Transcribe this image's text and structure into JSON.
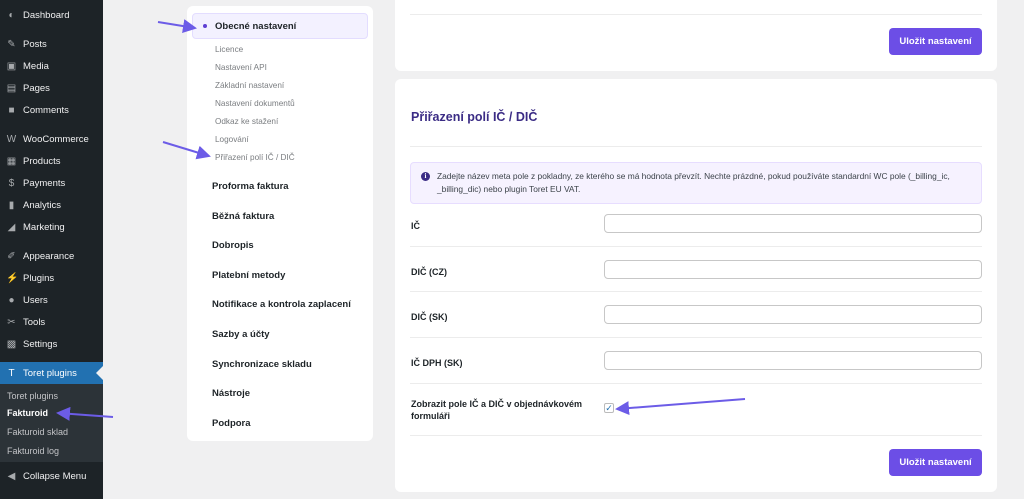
{
  "sidebar": {
    "items": [
      {
        "label": "Dashboard",
        "icon": "dashboard-icon",
        "glyph": "◐"
      },
      {
        "label": "Posts",
        "icon": "pin-icon",
        "glyph": "✎"
      },
      {
        "label": "Media",
        "icon": "media-icon",
        "glyph": "▣"
      },
      {
        "label": "Pages",
        "icon": "pages-icon",
        "glyph": "▤"
      },
      {
        "label": "Comments",
        "icon": "comments-icon",
        "glyph": "■"
      },
      {
        "label": "WooCommerce",
        "icon": "woocommerce-icon",
        "glyph": "W"
      },
      {
        "label": "Products",
        "icon": "products-icon",
        "glyph": "▦"
      },
      {
        "label": "Payments",
        "icon": "payments-icon",
        "glyph": "$"
      },
      {
        "label": "Analytics",
        "icon": "analytics-icon",
        "glyph": "▮"
      },
      {
        "label": "Marketing",
        "icon": "megaphone-icon",
        "glyph": "◢"
      },
      {
        "label": "Appearance",
        "icon": "brush-icon",
        "glyph": "✐"
      },
      {
        "label": "Plugins",
        "icon": "plugins-icon",
        "glyph": "⚡"
      },
      {
        "label": "Users",
        "icon": "users-icon",
        "glyph": "●"
      },
      {
        "label": "Tools",
        "icon": "wrench-icon",
        "glyph": "✂"
      },
      {
        "label": "Settings",
        "icon": "settings-icon",
        "glyph": "▩"
      },
      {
        "label": "Toret plugins",
        "icon": "toret-icon",
        "glyph": "T"
      },
      {
        "label": "Collapse Menu",
        "icon": "collapse-icon",
        "glyph": "◀"
      }
    ],
    "submenu": [
      "Toret plugins",
      "Fakturoid",
      "Fakturoid sklad",
      "Fakturoid log"
    ]
  },
  "nav": {
    "active": "Obecné nastavení",
    "subitems": [
      "Licence",
      "Nastavení API",
      "Základní nastavení",
      "Nastavení dokumentů",
      "Odkaz ke stažení",
      "Logování",
      "Přiřazení polí IČ / DIČ"
    ],
    "main": [
      "Proforma faktura",
      "Běžná faktura",
      "Dobropis",
      "Platební metody",
      "Notifikace a kontrola zaplacení",
      "Sazby a účty",
      "Synchronizace skladu",
      "Nástroje",
      "Podpora"
    ]
  },
  "top_card": {
    "save_label": "Uložit nastavení"
  },
  "main_card": {
    "title": "Přiřazení polí IČ / DIČ",
    "notice": "Zadejte název meta pole z pokladny, ze kterého se má hodnota převzít. Nechte prázdné, pokud používáte standardní WC pole (_billing_ic, _billing_dic) nebo plugin Toret EU VAT.",
    "fields": [
      {
        "label": "IČ",
        "value": ""
      },
      {
        "label": "DIČ (CZ)",
        "value": ""
      },
      {
        "label": "DIČ (SK)",
        "value": ""
      },
      {
        "label": "IČ DPH (SK)",
        "value": ""
      }
    ],
    "checkbox_label": "Zobrazit pole IČ a DIČ v objednávkovém formuláři",
    "checkbox_checked": true,
    "save_label": "Uložit nastavení"
  },
  "colors": {
    "accent": "#6c4ee6",
    "wp_sidebar": "#1d2327",
    "wp_active": "#2271b1",
    "annotation_arrow": "#6c5ce7"
  }
}
